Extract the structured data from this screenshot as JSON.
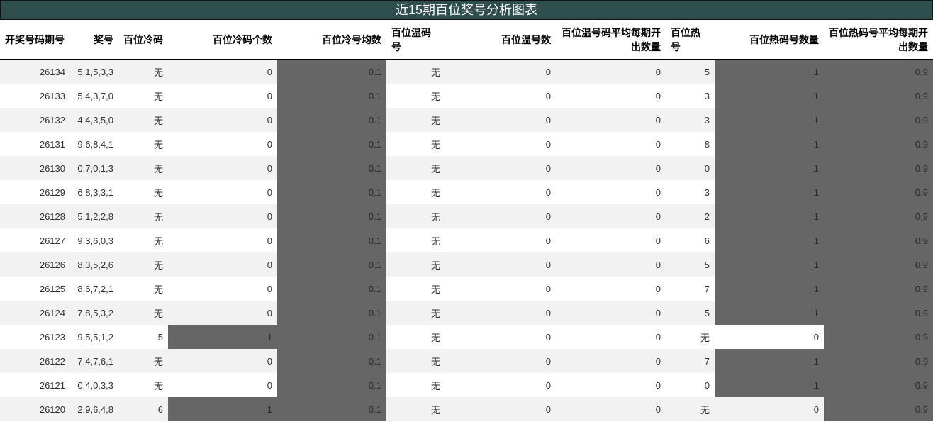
{
  "title": "近15期百位奖号分析图表",
  "columns": [
    "开奖号码期号",
    "奖号",
    "百位冷码",
    "百位冷码个数",
    "百位冷号均数",
    "百位温码号",
    "百位温号数",
    "百位温号码平均每期开出数量",
    "百位热号",
    "百位热码号数量",
    "百位热码号平均每期开出数量"
  ],
  "shading": {
    "dark": "#666666",
    "row_alt": "#f2f2f2",
    "header_bg": "#2f4f4f"
  },
  "rows": [
    [
      "26134",
      "5,1,5,3,3",
      "无",
      "0",
      "0.1",
      "无",
      "0",
      "0",
      "5",
      "1",
      "0.9"
    ],
    [
      "26133",
      "5,4,3,7,0",
      "无",
      "0",
      "0.1",
      "无",
      "0",
      "0",
      "3",
      "1",
      "0.9"
    ],
    [
      "26132",
      "4,4,3,5,0",
      "无",
      "0",
      "0.1",
      "无",
      "0",
      "0",
      "3",
      "1",
      "0.9"
    ],
    [
      "26131",
      "9,6,8,4,1",
      "无",
      "0",
      "0.1",
      "无",
      "0",
      "0",
      "8",
      "1",
      "0.9"
    ],
    [
      "26130",
      "0,7,0,1,3",
      "无",
      "0",
      "0.1",
      "无",
      "0",
      "0",
      "0",
      "1",
      "0.9"
    ],
    [
      "26129",
      "6,8,3,3,1",
      "无",
      "0",
      "0.1",
      "无",
      "0",
      "0",
      "3",
      "1",
      "0.9"
    ],
    [
      "26128",
      "5,1,2,2,8",
      "无",
      "0",
      "0.1",
      "无",
      "0",
      "0",
      "2",
      "1",
      "0.9"
    ],
    [
      "26127",
      "9,3,6,0,3",
      "无",
      "0",
      "0.1",
      "无",
      "0",
      "0",
      "6",
      "1",
      "0.9"
    ],
    [
      "26126",
      "8,3,5,2,6",
      "无",
      "0",
      "0.1",
      "无",
      "0",
      "0",
      "5",
      "1",
      "0.9"
    ],
    [
      "26125",
      "8,6,7,2,1",
      "无",
      "0",
      "0.1",
      "无",
      "0",
      "0",
      "7",
      "1",
      "0.9"
    ],
    [
      "26124",
      "7,8,5,3,2",
      "无",
      "0",
      "0.1",
      "无",
      "0",
      "0",
      "5",
      "1",
      "0.9"
    ],
    [
      "26123",
      "9,5,5,1,2",
      "5",
      "1",
      "0.1",
      "无",
      "0",
      "0",
      "无",
      "0",
      "0.9"
    ],
    [
      "26122",
      "7,4,7,6,1",
      "无",
      "0",
      "0.1",
      "无",
      "0",
      "0",
      "7",
      "1",
      "0.9"
    ],
    [
      "26121",
      "0,4,0,3,3",
      "无",
      "0",
      "0.1",
      "无",
      "0",
      "0",
      "0",
      "1",
      "0.9"
    ],
    [
      "26120",
      "2,9,6,4,8",
      "6",
      "1",
      "0.1",
      "无",
      "0",
      "0",
      "无",
      "0",
      "0.9"
    ]
  ]
}
